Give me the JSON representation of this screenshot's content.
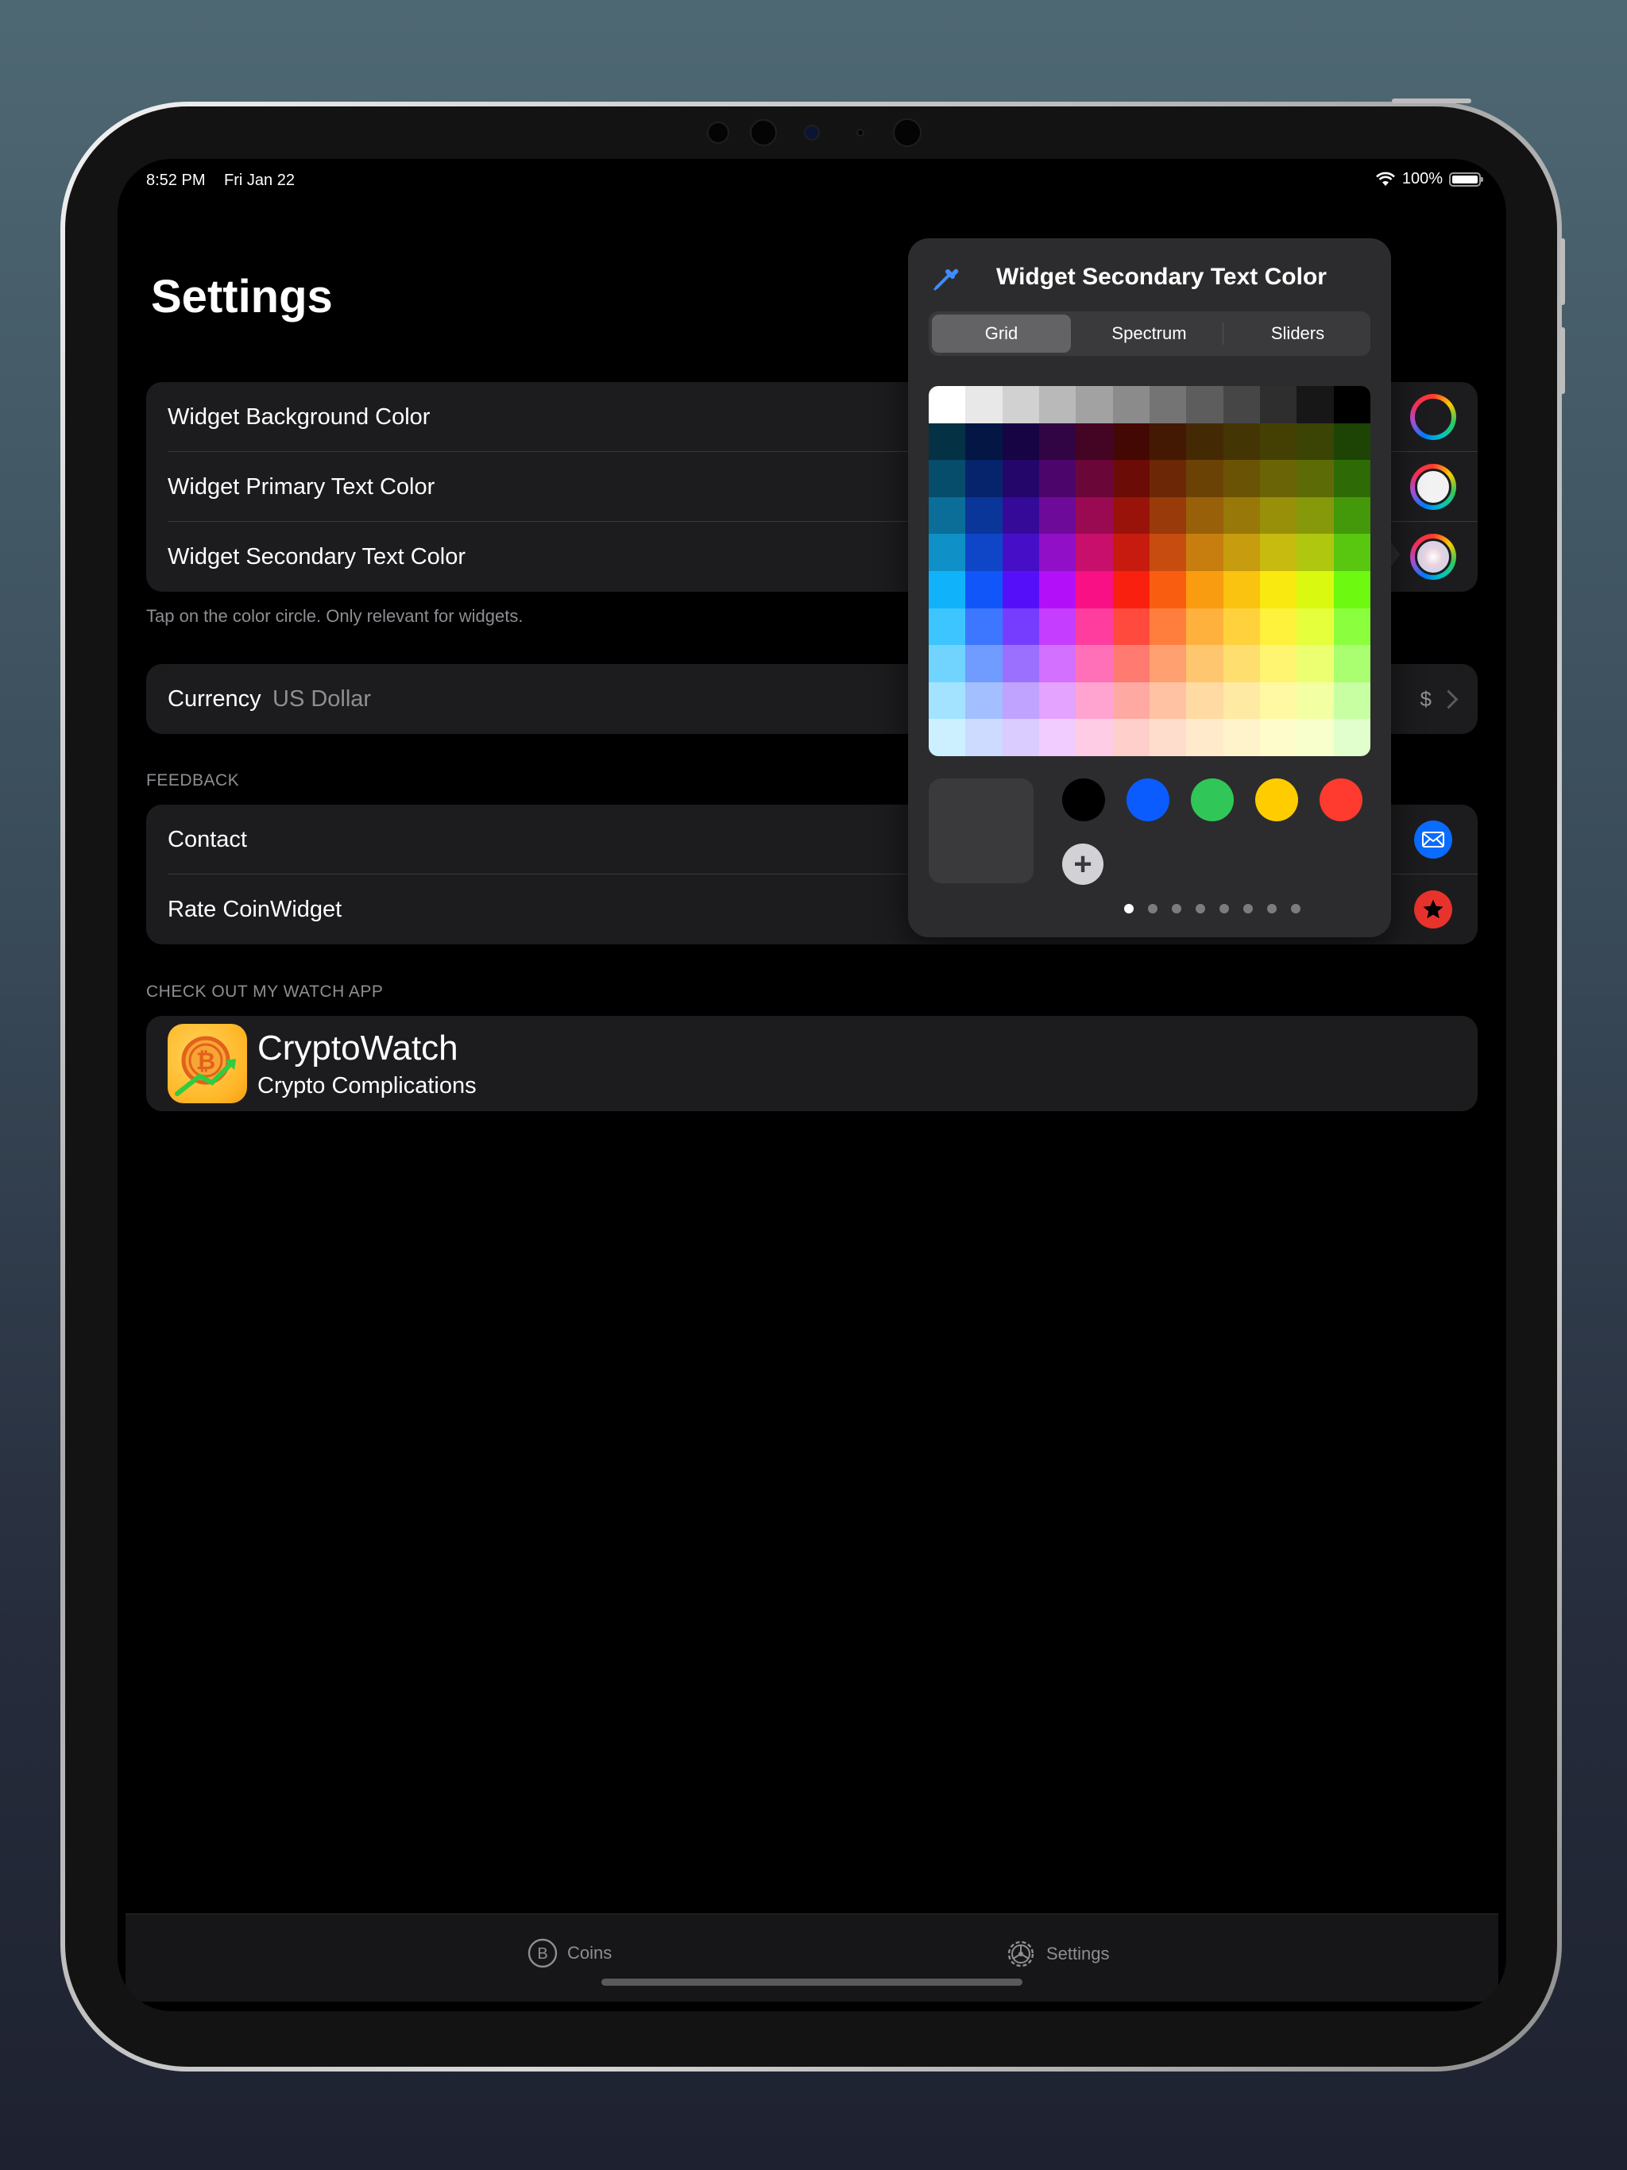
{
  "status_bar": {
    "time": "8:52 PM",
    "date": "Fri Jan 22",
    "battery": "100%"
  },
  "page": {
    "title": "Settings"
  },
  "colors_group": {
    "rows": [
      {
        "label": "Widget Background Color",
        "current_color": "#1c1c1e"
      },
      {
        "label": "Widget Primary Text Color",
        "current_color": "#f2f2f2"
      },
      {
        "label": "Widget Secondary Text Color",
        "current_color": "#e6d9e6"
      }
    ],
    "footer": "Tap on the color circle. Only relevant for widgets."
  },
  "currency": {
    "label": "Currency",
    "value": "US Dollar",
    "symbol": "$"
  },
  "feedback": {
    "header": "FEEDBACK",
    "rows": [
      {
        "label": "Contact",
        "icon": "envelope-icon",
        "color": "#0a6cff"
      },
      {
        "label": "Rate CoinWidget",
        "icon": "star-icon",
        "color": "#e8332d"
      }
    ]
  },
  "watch_app": {
    "header": "CHECK OUT MY WATCH APP",
    "title": "CryptoWatch",
    "subtitle": "Crypto Complications"
  },
  "tab_bar": {
    "tabs": [
      {
        "label": "Coins",
        "icon": "bitcoin-icon"
      },
      {
        "label": "Settings",
        "icon": "gear-icon"
      }
    ],
    "selected": 1
  },
  "color_picker": {
    "title": "Widget Secondary Text Color",
    "segments": [
      "Grid",
      "Spectrum",
      "Sliders"
    ],
    "active_segment": 0,
    "swatches": [
      "#000000",
      "#0a5cff",
      "#30c758",
      "#ffcc00",
      "#ff3b30"
    ],
    "page_count": 8,
    "active_page": 0
  }
}
